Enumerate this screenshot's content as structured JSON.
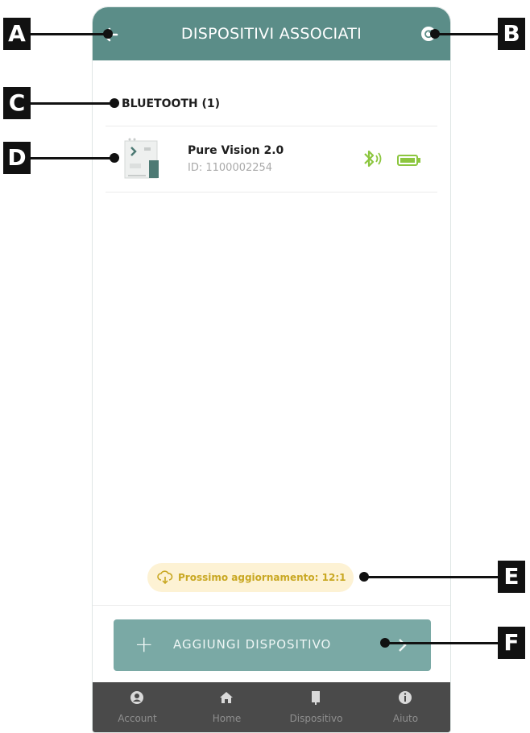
{
  "header": {
    "title": "DISPOSITIVI ASSOCIATI"
  },
  "section": {
    "label": "BLUETOOTH (1)"
  },
  "devices": [
    {
      "name": "Pure Vision 2.0",
      "id_text": "ID: 1100002254"
    }
  ],
  "update": {
    "text": "Prossimo aggiornamento: 12:1"
  },
  "add_button": {
    "label": "AGGIUNGI DISPOSITIVO"
  },
  "nav": {
    "items": [
      {
        "label": "Account",
        "icon": "account-icon"
      },
      {
        "label": "Home",
        "icon": "home-icon"
      },
      {
        "label": "Dispositivo",
        "icon": "device-icon"
      },
      {
        "label": "Aiuto",
        "icon": "info-icon"
      }
    ]
  },
  "callouts": [
    "A",
    "B",
    "C",
    "D",
    "E",
    "F"
  ],
  "colors": {
    "header": "#5b8d88",
    "accent_green": "#8cc63f",
    "update_text": "#c9a823",
    "add_button": "#7aa9a5",
    "nav_bg": "#4a4a4a"
  }
}
